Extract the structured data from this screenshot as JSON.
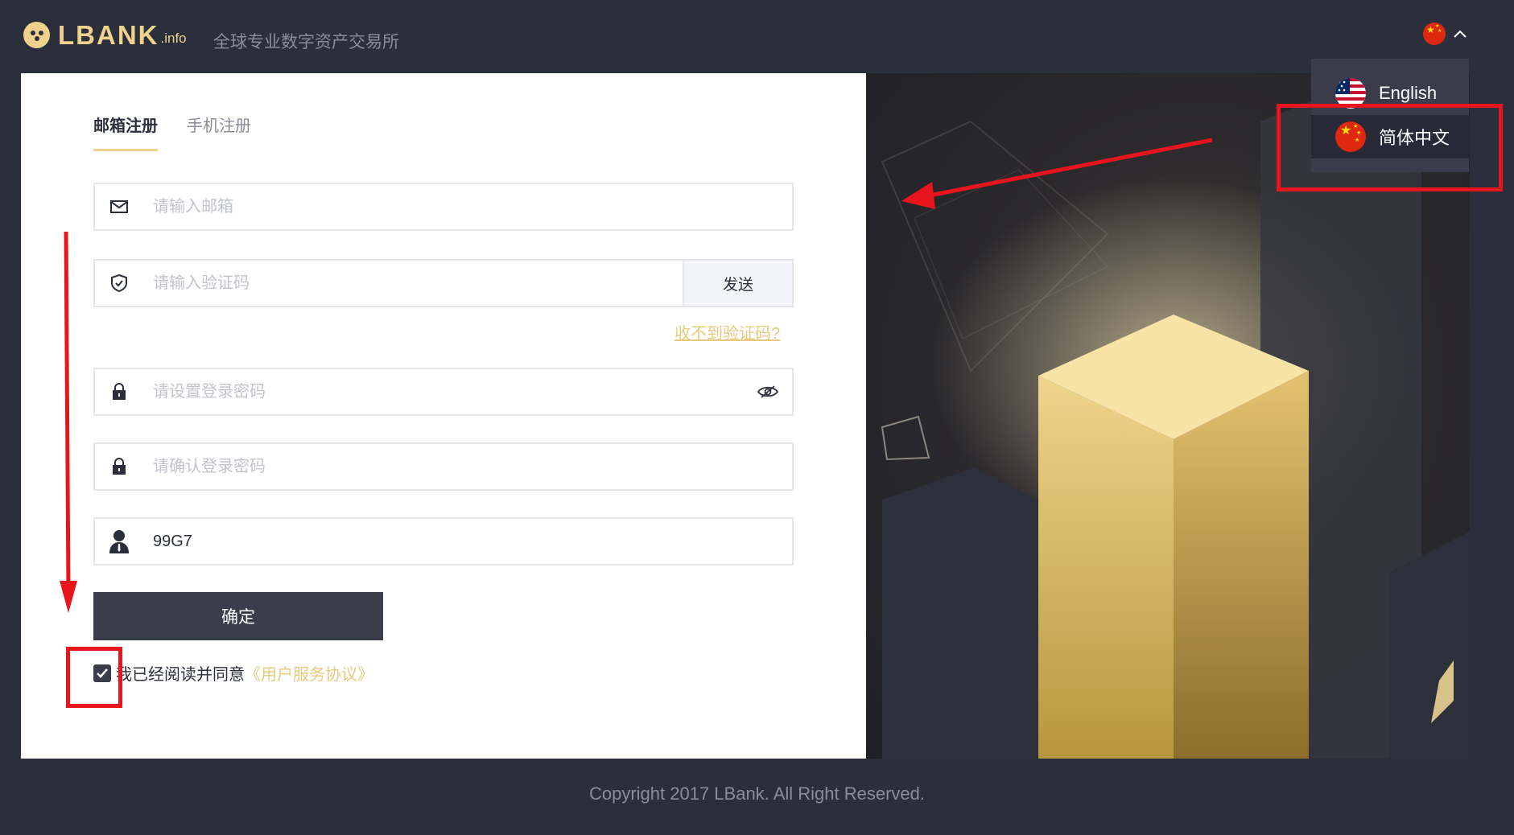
{
  "header": {
    "logo_text": "LBANK",
    "logo_suffix": ".info",
    "tagline": "全球专业数字资产交易所",
    "language_toggle_icon": "china-flag-icon"
  },
  "tabs": [
    {
      "label": "邮箱注册",
      "active": true
    },
    {
      "label": "手机注册",
      "active": false
    }
  ],
  "form": {
    "email": {
      "placeholder": "请输入邮箱",
      "value": "",
      "icon": "mail-icon"
    },
    "code": {
      "placeholder": "请输入验证码",
      "value": "",
      "icon": "shield-icon",
      "send_label": "发送"
    },
    "no_code_link": "收不到验证码?",
    "password": {
      "placeholder": "请设置登录密码",
      "value": "",
      "icon": "lock-icon"
    },
    "confirm_password": {
      "placeholder": "请确认登录密码",
      "value": "",
      "icon": "lock-icon"
    },
    "invite": {
      "placeholder": "",
      "value": "99G7",
      "icon": "user-icon"
    },
    "submit_label": "确定",
    "agree_text": "我已经阅读并同意",
    "agree_link": "《用户服务协议》",
    "agree_checked": true
  },
  "language_dropdown": {
    "items": [
      {
        "label": "English",
        "flag": "us-flag-icon",
        "selected": false
      },
      {
        "label": "简体中文",
        "flag": "china-flag-icon",
        "selected": true
      }
    ]
  },
  "footer": {
    "copyright": "Copyright 2017 LBank. All Right Reserved."
  },
  "colors": {
    "background": "#2b2e3b",
    "accent_gold": "#f1d28d",
    "button_dark": "#3c3d4a",
    "annotation_red": "#e8161c"
  }
}
